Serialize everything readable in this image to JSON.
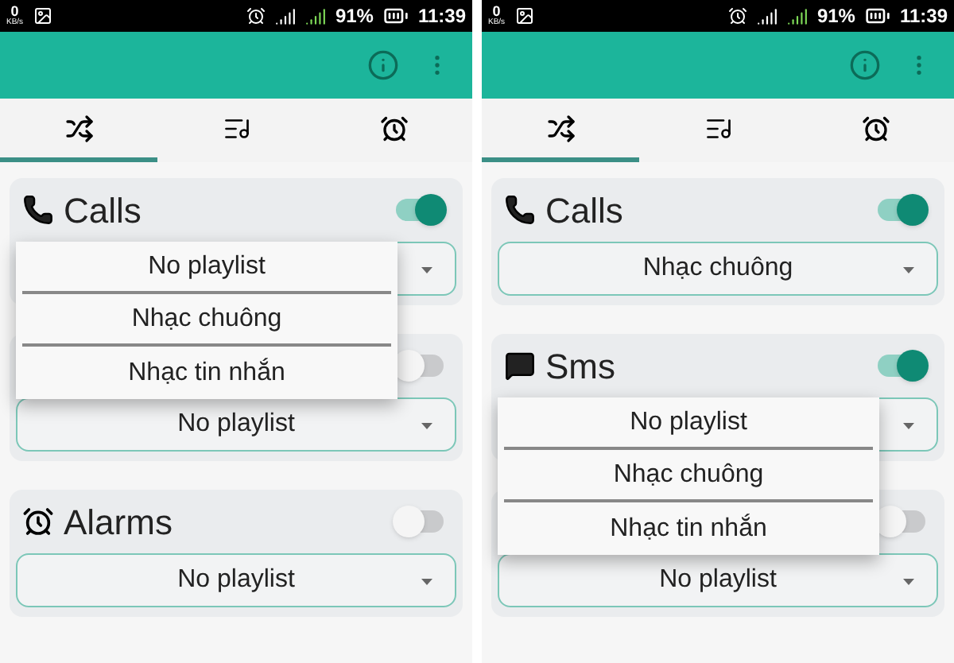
{
  "phones": [
    {
      "status_bar": {
        "speed": "0",
        "speed_unit": "KB/s",
        "battery": "91%",
        "time": "11:39"
      },
      "tabs": [
        {
          "kind": "shuffle",
          "selected": true
        },
        {
          "kind": "playlist",
          "selected": false
        },
        {
          "kind": "alarm",
          "selected": false
        }
      ],
      "sections": [
        {
          "kind": "phone",
          "title": "Calls",
          "on": true,
          "expanded": true
        },
        {
          "on": false,
          "value": "No playlist",
          "expanded": false
        },
        {
          "kind": "alarm",
          "title": "Alarms",
          "on": false,
          "value": "No playlist",
          "expanded": false
        }
      ],
      "menu": [
        "No playlist",
        "Nhạc chuông",
        "Nhạc tin nhắn"
      ]
    },
    {
      "status_bar": {
        "speed": "0",
        "speed_unit": "KB/s",
        "battery": "91%",
        "time": "11:39"
      },
      "tabs": [
        {
          "kind": "shuffle",
          "selected": true
        },
        {
          "kind": "playlist",
          "selected": false
        },
        {
          "kind": "alarm",
          "selected": false
        }
      ],
      "sections": [
        {
          "kind": "phone",
          "title": "Calls",
          "on": true,
          "value": "Nhạc chuông",
          "expanded": false
        },
        {
          "kind": "message",
          "title": "Sms",
          "on": true,
          "expanded": true
        },
        {
          "on": false,
          "value": "No playlist",
          "expanded": false
        }
      ],
      "menu": [
        "No playlist",
        "Nhạc chuông",
        "Nhạc tin nhắn"
      ]
    }
  ]
}
